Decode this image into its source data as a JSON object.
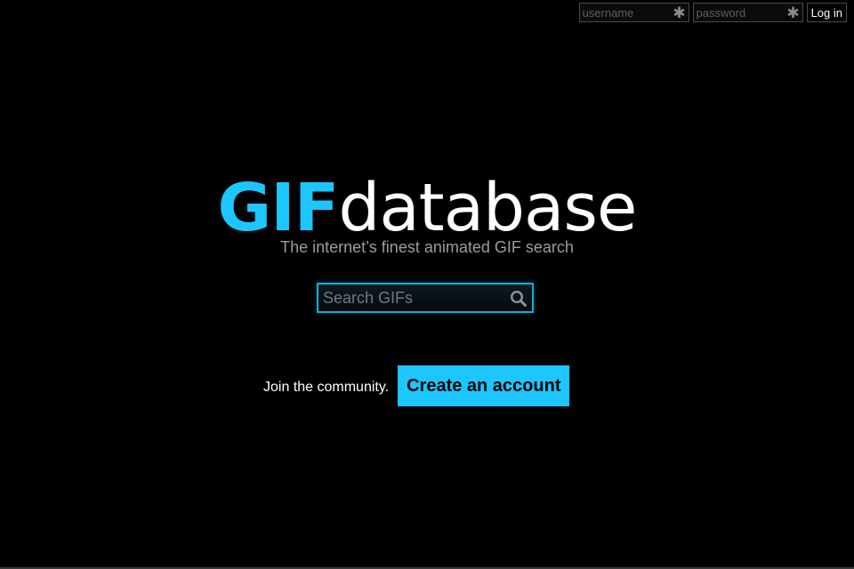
{
  "login": {
    "username_placeholder": "username",
    "password_placeholder": "password",
    "login_label": "Log in",
    "required_icon": "asterisk-icon"
  },
  "logo": {
    "part1": "GIF",
    "part2": "database",
    "accent_color": "#1ec6ff"
  },
  "tagline": "The internet’s finest animated GIF search",
  "search": {
    "placeholder": "Search GIFs",
    "icon": "search-icon"
  },
  "join": {
    "text": "Join the community.",
    "button_label": "Create an account"
  },
  "colors": {
    "background": "#000000",
    "accent": "#1ec6ff"
  }
}
